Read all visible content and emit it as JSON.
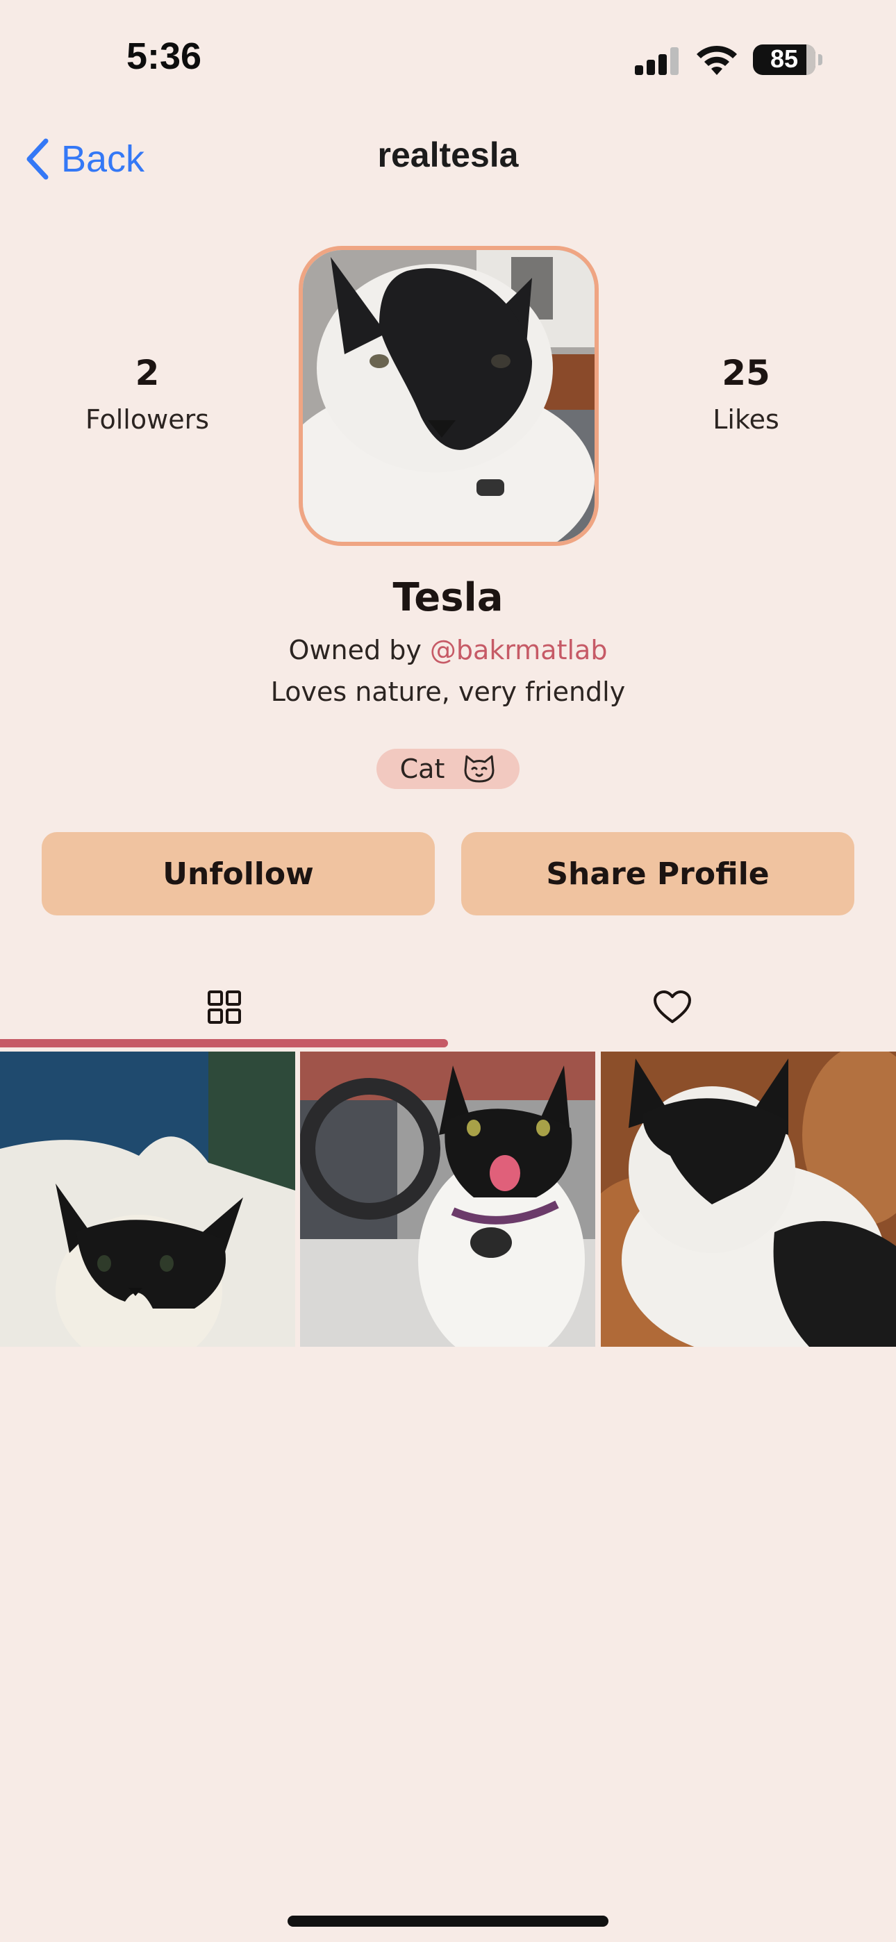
{
  "status_bar": {
    "time": "5:36",
    "battery": "85"
  },
  "nav": {
    "back_label": "Back",
    "title": "realtesla"
  },
  "stats": {
    "followers": {
      "value": "2",
      "label": "Followers"
    },
    "likes": {
      "value": "25",
      "label": "Likes"
    }
  },
  "profile": {
    "name": "Tesla",
    "owner_prefix": "Owned by",
    "owner_handle": "@bakrmatlab",
    "bio": "Loves nature, very friendly",
    "tag": "Cat"
  },
  "actions": {
    "unfollow": "Unfollow",
    "share": "Share Profile"
  },
  "tabs": [
    {
      "icon": "grid-icon",
      "active": true
    },
    {
      "icon": "heart-icon",
      "active": false
    }
  ],
  "icons": {
    "back": "chevron-left-icon",
    "tag": "cat-face-icon",
    "signal": "cellular-signal-icon",
    "wifi": "wifi-icon",
    "battery": "battery-icon"
  },
  "colors": {
    "background": "#f7ebe6",
    "accent": "#c65a66",
    "button": "#f0c3a0",
    "avatar_border": "#efa583",
    "tag_background": "#f2c9c0",
    "link": "#3478f6"
  }
}
